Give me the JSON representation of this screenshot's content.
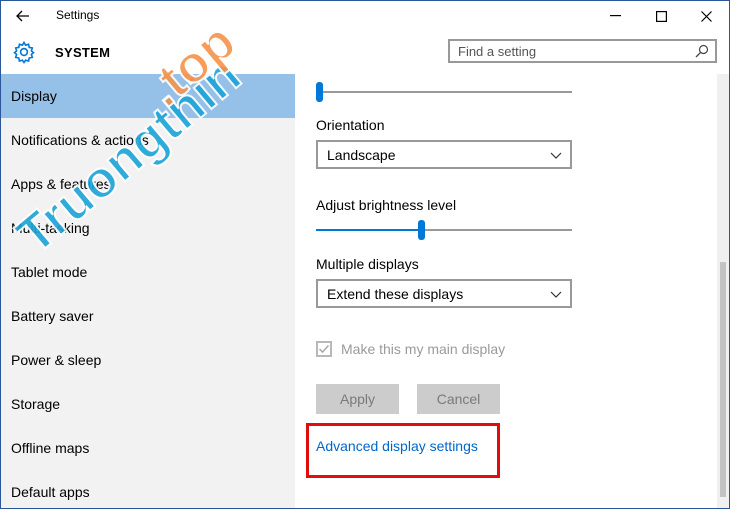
{
  "window": {
    "title": "Settings",
    "back_icon": "back-arrow-icon",
    "minimize_glyph": "—",
    "maximize_glyph": "☐",
    "close_glyph": "✕"
  },
  "header": {
    "icon": "gear-icon",
    "title": "SYSTEM",
    "search_placeholder": "Find a setting"
  },
  "sidebar": {
    "items": [
      {
        "label": "Display",
        "active": true
      },
      {
        "label": "Notifications & actions"
      },
      {
        "label": "Apps & features"
      },
      {
        "label": "Multi-tasking"
      },
      {
        "label": "Tablet mode"
      },
      {
        "label": "Battery saver"
      },
      {
        "label": "Power & sleep"
      },
      {
        "label": "Storage"
      },
      {
        "label": "Offline maps"
      },
      {
        "label": "Default apps"
      }
    ]
  },
  "main": {
    "scale_slider_level": 0.0,
    "orientation_label": "Orientation",
    "orientation_value": "Landscape",
    "brightness_label": "Adjust brightness level",
    "brightness_level": 0.4,
    "multiple_displays_label": "Multiple displays",
    "multiple_displays_value": "Extend these displays",
    "main_display_checkbox_label": "Make this my main display",
    "main_display_checked": true,
    "apply_label": "Apply",
    "cancel_label": "Cancel",
    "advanced_link": "Advanced display settings"
  },
  "watermark": "Truongthin.top",
  "colors": {
    "accent": "#0078d7",
    "active_nav": "#95c1e8",
    "highlight_box": "#e10d0d",
    "watermark_orange": "#f7934a",
    "watermark_blue": "#1aa4d8"
  }
}
